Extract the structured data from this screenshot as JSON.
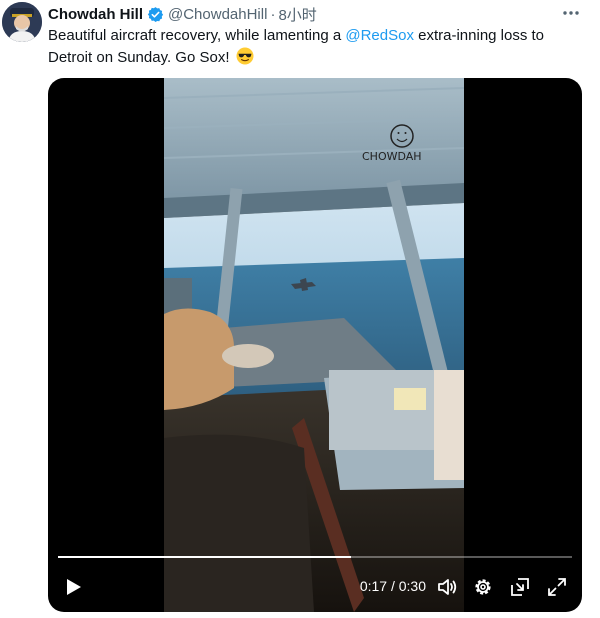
{
  "author": {
    "display_name": "Chowdah Hill",
    "handle": "@ChowdahHill",
    "separator": "·",
    "timestamp": "8小时",
    "verified_color": "#1d9bf0"
  },
  "tweet": {
    "text_before": "Beautiful aircraft recovery, while lamenting a ",
    "mention": "@RedSox",
    "text_after": " extra-inning loss to Detroit on Sunday. Go Sox!",
    "emoji": "sunglasses-emoji"
  },
  "video": {
    "sketch_caption": "CHOWDAH",
    "current_time": "0:17",
    "time_separator": " / ",
    "duration": "0:30",
    "progress_fraction": 0.57
  },
  "icons": {
    "more": "more-options-icon",
    "play": "play-icon",
    "volume": "volume-icon",
    "settings": "settings-icon",
    "pip": "pip-icon",
    "fullscreen": "fullscreen-icon"
  },
  "colors": {
    "link": "#1d9bf0",
    "secondary_text": "#536471",
    "primary_text": "#0f1419"
  }
}
